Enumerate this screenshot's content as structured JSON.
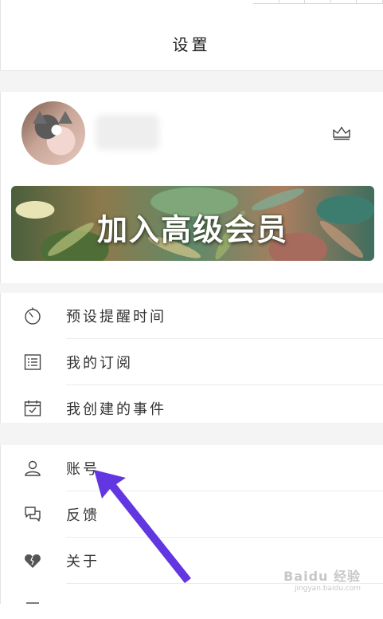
{
  "header": {
    "title": "设置"
  },
  "profile": {
    "crown_icon": "crown-icon"
  },
  "banner": {
    "text": "加入高级会员"
  },
  "menu_group_1": [
    {
      "label": "预设提醒时间",
      "icon": "timer-icon"
    },
    {
      "label": "我的订阅",
      "icon": "list-icon"
    },
    {
      "label": "我创建的事件",
      "icon": "calendar-check-icon"
    }
  ],
  "menu_group_2": [
    {
      "label": "账号",
      "icon": "user-icon"
    },
    {
      "label": "反馈",
      "icon": "chat-icon"
    },
    {
      "label": "关于",
      "icon": "heart-icon"
    }
  ],
  "watermark": {
    "main": "Baidu 经验",
    "sub": "jingyan.baidu.com"
  },
  "colors": {
    "arrow": "#6236e0",
    "background": "#ffffff",
    "gap": "#f4f4f4"
  }
}
